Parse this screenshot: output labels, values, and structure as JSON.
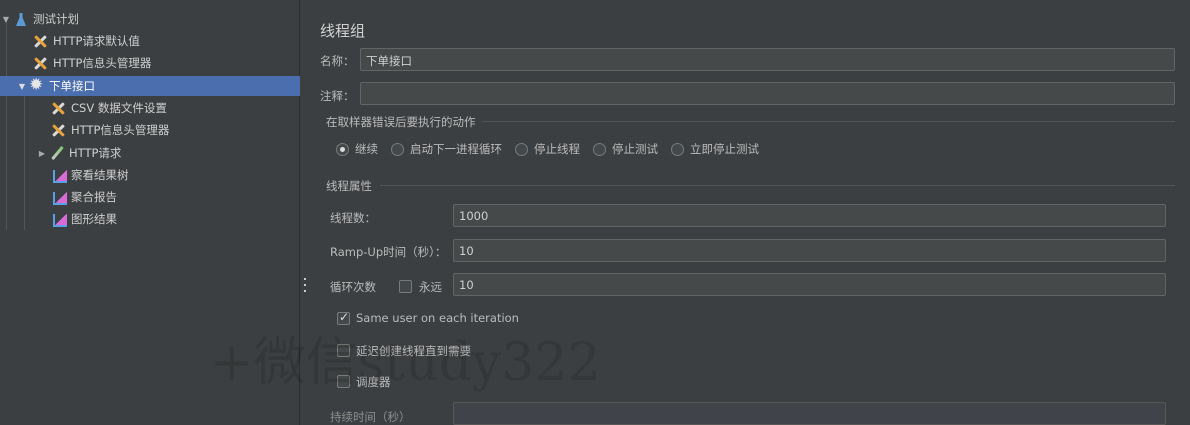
{
  "tree": {
    "items": [
      {
        "label": "测试计划",
        "icon": "flask-icon",
        "expanded": true
      },
      {
        "label": "HTTP请求默认值",
        "icon": "tool-icon"
      },
      {
        "label": "HTTP信息头管理器",
        "icon": "tool-icon"
      },
      {
        "label": "下单接口",
        "icon": "gear-icon",
        "expanded": true,
        "selected": true
      },
      {
        "label": "CSV 数据文件设置",
        "icon": "tool-icon"
      },
      {
        "label": "HTTP信息头管理器",
        "icon": "tool-icon"
      },
      {
        "label": "HTTP请求",
        "icon": "pipette-icon",
        "expanded": false
      },
      {
        "label": "察看结果树",
        "icon": "chart-icon"
      },
      {
        "label": "聚合报告",
        "icon": "chart-icon"
      },
      {
        "label": "图形结果",
        "icon": "chart-icon"
      }
    ]
  },
  "panel": {
    "title": "线程组",
    "name_label": "名称：",
    "name_value": "下单接口",
    "comment_label": "注释：",
    "comment_value": "",
    "error_group": {
      "title": "在取样器错误后要执行的动作",
      "options": [
        "继续",
        "启动下一进程循环",
        "停止线程",
        "停止测试",
        "立即停止测试"
      ],
      "selected": "继续"
    },
    "thread_props": {
      "title": "线程属性",
      "threads_label": "线程数：",
      "threads_value": "1000",
      "rampup_label": "Ramp-Up时间（秒）：",
      "rampup_value": "10",
      "loop_label": "循环次数",
      "forever_label": "永远",
      "forever_checked": false,
      "loop_value": "10",
      "same_user_label": "Same user on each iteration",
      "same_user_checked": true,
      "delay_label": "延迟创建线程直到需要",
      "delay_checked": false,
      "scheduler_label": "调度器",
      "scheduler_checked": false,
      "duration_label": "持续时间（秒）",
      "duration_value": ""
    }
  },
  "watermark": "+微信study322",
  "colors": {
    "background": "#3c3f41",
    "selection": "#4b6eaf",
    "field": "#45494a"
  }
}
